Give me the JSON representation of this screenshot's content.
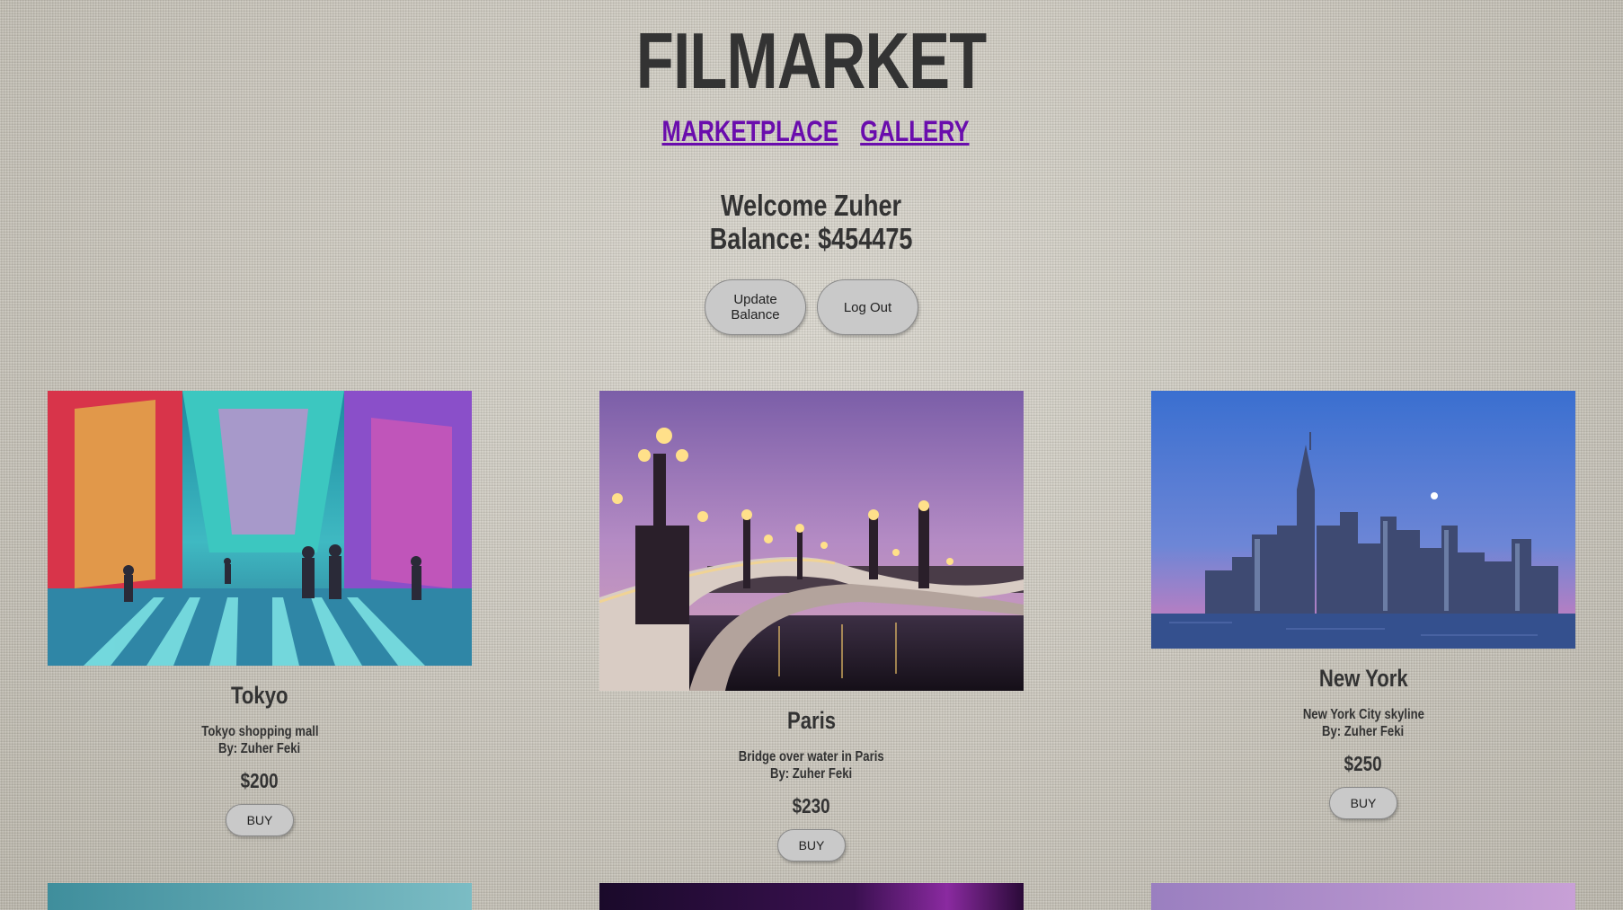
{
  "app": {
    "title": "FILMARKET"
  },
  "nav": {
    "marketplace": "MARKETPLACE",
    "gallery": "GALLERY"
  },
  "user": {
    "welcome": "Welcome Zuher",
    "balance": "Balance: $454475"
  },
  "buttons": {
    "update_balance": "Update Balance",
    "log_out": "Log Out"
  },
  "cards": [
    {
      "title": "Tokyo",
      "description": "Tokyo shopping mall",
      "author": "By: Zuher Feki",
      "price": "$200",
      "buy_label": "BUY",
      "image": "tokyo-street-photo"
    },
    {
      "title": "Paris",
      "description": "Bridge over water in Paris",
      "author": "By: Zuher Feki",
      "price": "$230",
      "buy_label": "BUY",
      "image": "paris-bridge-photo"
    },
    {
      "title": "New York",
      "description": "New York City skyline",
      "author": "By: Zuher Feki",
      "price": "$250",
      "buy_label": "BUY",
      "image": "new-york-skyline-photo"
    }
  ],
  "colors": {
    "nav_link": "#6a0dad",
    "text": "#333333",
    "button": "#c9c9c9"
  }
}
